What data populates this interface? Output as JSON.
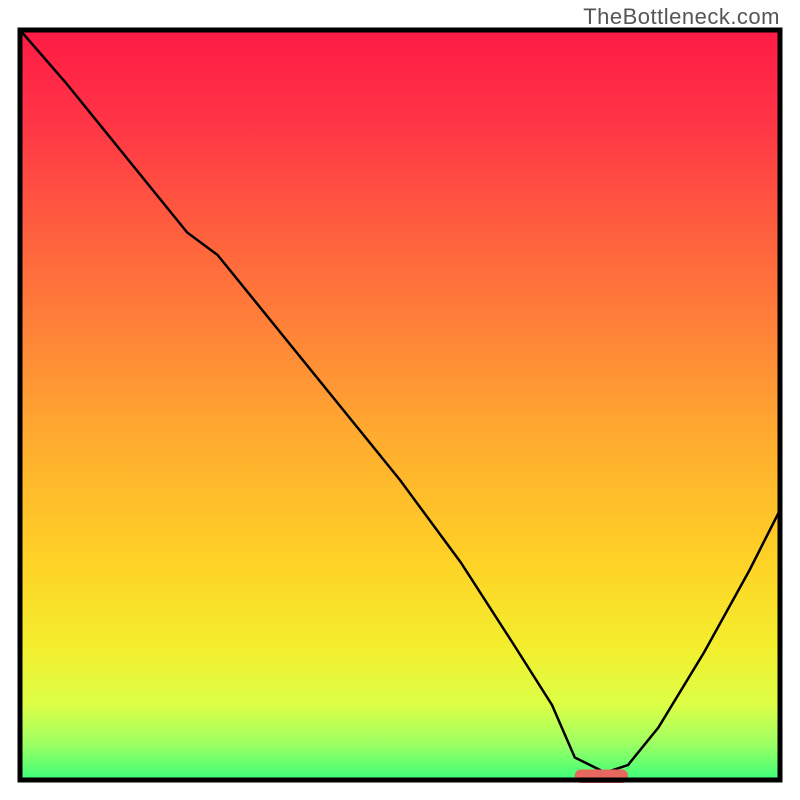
{
  "watermark": "TheBottleneck.com",
  "colors": {
    "border": "#000000",
    "curve": "#000000",
    "marker": "#e8675e",
    "gradient_stops": [
      {
        "offset": 0.0,
        "color": "#ff1b45"
      },
      {
        "offset": 0.12,
        "color": "#ff3446"
      },
      {
        "offset": 0.25,
        "color": "#ff5a3f"
      },
      {
        "offset": 0.4,
        "color": "#ff8338"
      },
      {
        "offset": 0.55,
        "color": "#ffad2f"
      },
      {
        "offset": 0.7,
        "color": "#ffd026"
      },
      {
        "offset": 0.82,
        "color": "#f4ee2d"
      },
      {
        "offset": 0.9,
        "color": "#dcff46"
      },
      {
        "offset": 0.95,
        "color": "#a0ff62"
      },
      {
        "offset": 1.0,
        "color": "#3cff7a"
      }
    ]
  },
  "chart_data": {
    "type": "line",
    "title": "",
    "xlabel": "",
    "ylabel": "",
    "xlim": [
      0,
      100
    ],
    "ylim": [
      0,
      100
    ],
    "note": "Bottleneck-style curve: high on left, descends steeply, flat minimum around x≈73-80, rises toward right edge.",
    "series": [
      {
        "name": "bottleneck-curve",
        "x": [
          0,
          6,
          14,
          22,
          26,
          34,
          42,
          50,
          58,
          65,
          70,
          73,
          77,
          80,
          84,
          90,
          96,
          100
        ],
        "values": [
          100,
          93,
          83,
          73,
          70,
          60,
          50,
          40,
          29,
          18,
          10,
          3,
          1,
          2,
          7,
          17,
          28,
          36
        ]
      }
    ],
    "marker": {
      "note": "small rounded salmon bar at the minimum of the curve",
      "x_start": 73,
      "x_end": 80,
      "y": 0.5,
      "thickness_pct": 1.8
    }
  }
}
